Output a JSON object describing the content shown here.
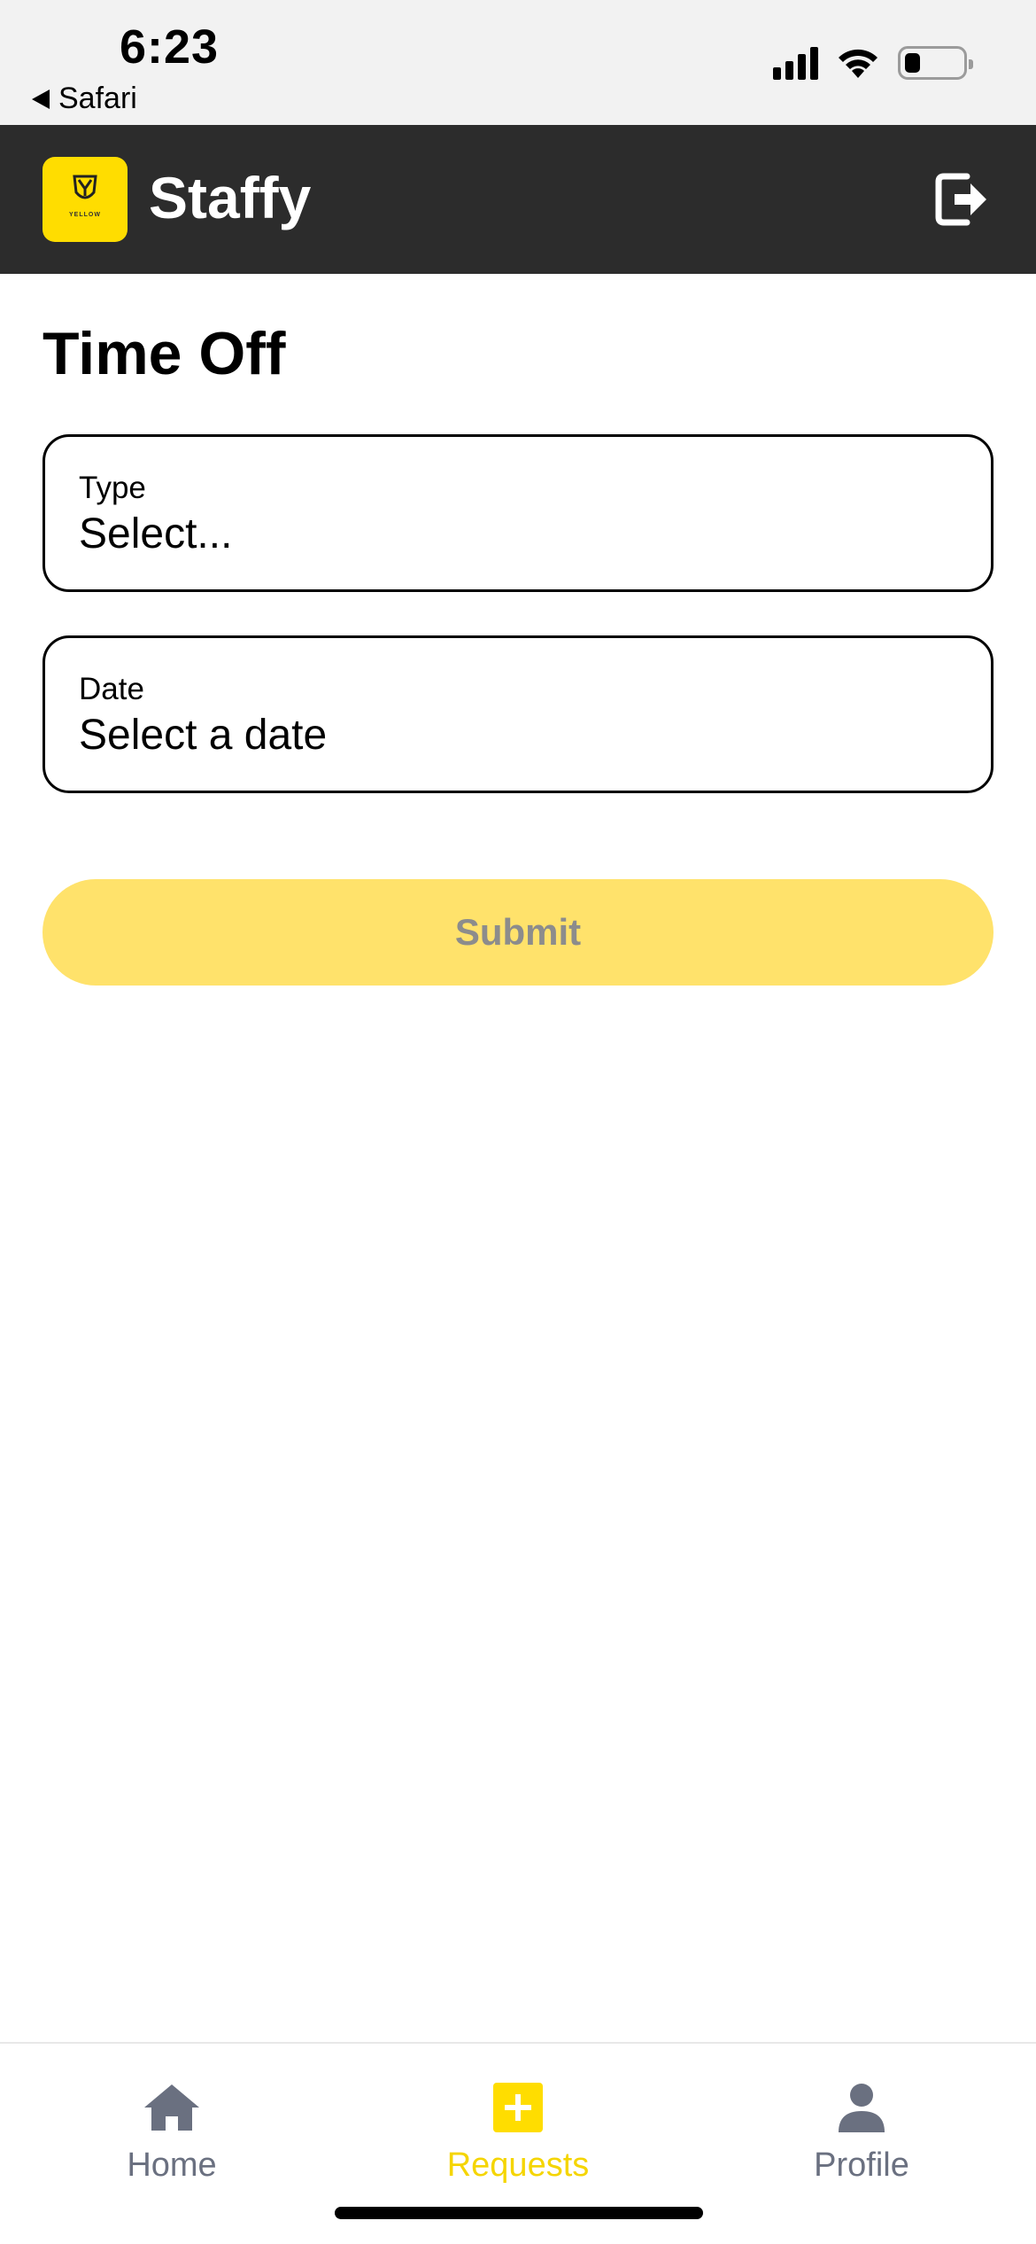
{
  "status_bar": {
    "time": "6:23",
    "back_label": "Safari"
  },
  "header": {
    "app_name": "Staffy",
    "logo_text": "YELLOW",
    "logout_icon": "logout-icon"
  },
  "page": {
    "title": "Time Off"
  },
  "form": {
    "type": {
      "label": "Type",
      "value": "Select..."
    },
    "date": {
      "label": "Date",
      "value": "Select a date"
    },
    "submit_label": "Submit"
  },
  "tabs": [
    {
      "label": "Home",
      "icon": "home-icon",
      "active": false
    },
    {
      "label": "Requests",
      "icon": "plus-square-icon",
      "active": true
    },
    {
      "label": "Profile",
      "icon": "person-icon",
      "active": false
    }
  ],
  "colors": {
    "accent": "#ffdd00",
    "header_bg": "#2c2c2c",
    "submit_bg": "#ffe26b",
    "tab_inactive": "#6a7080"
  }
}
